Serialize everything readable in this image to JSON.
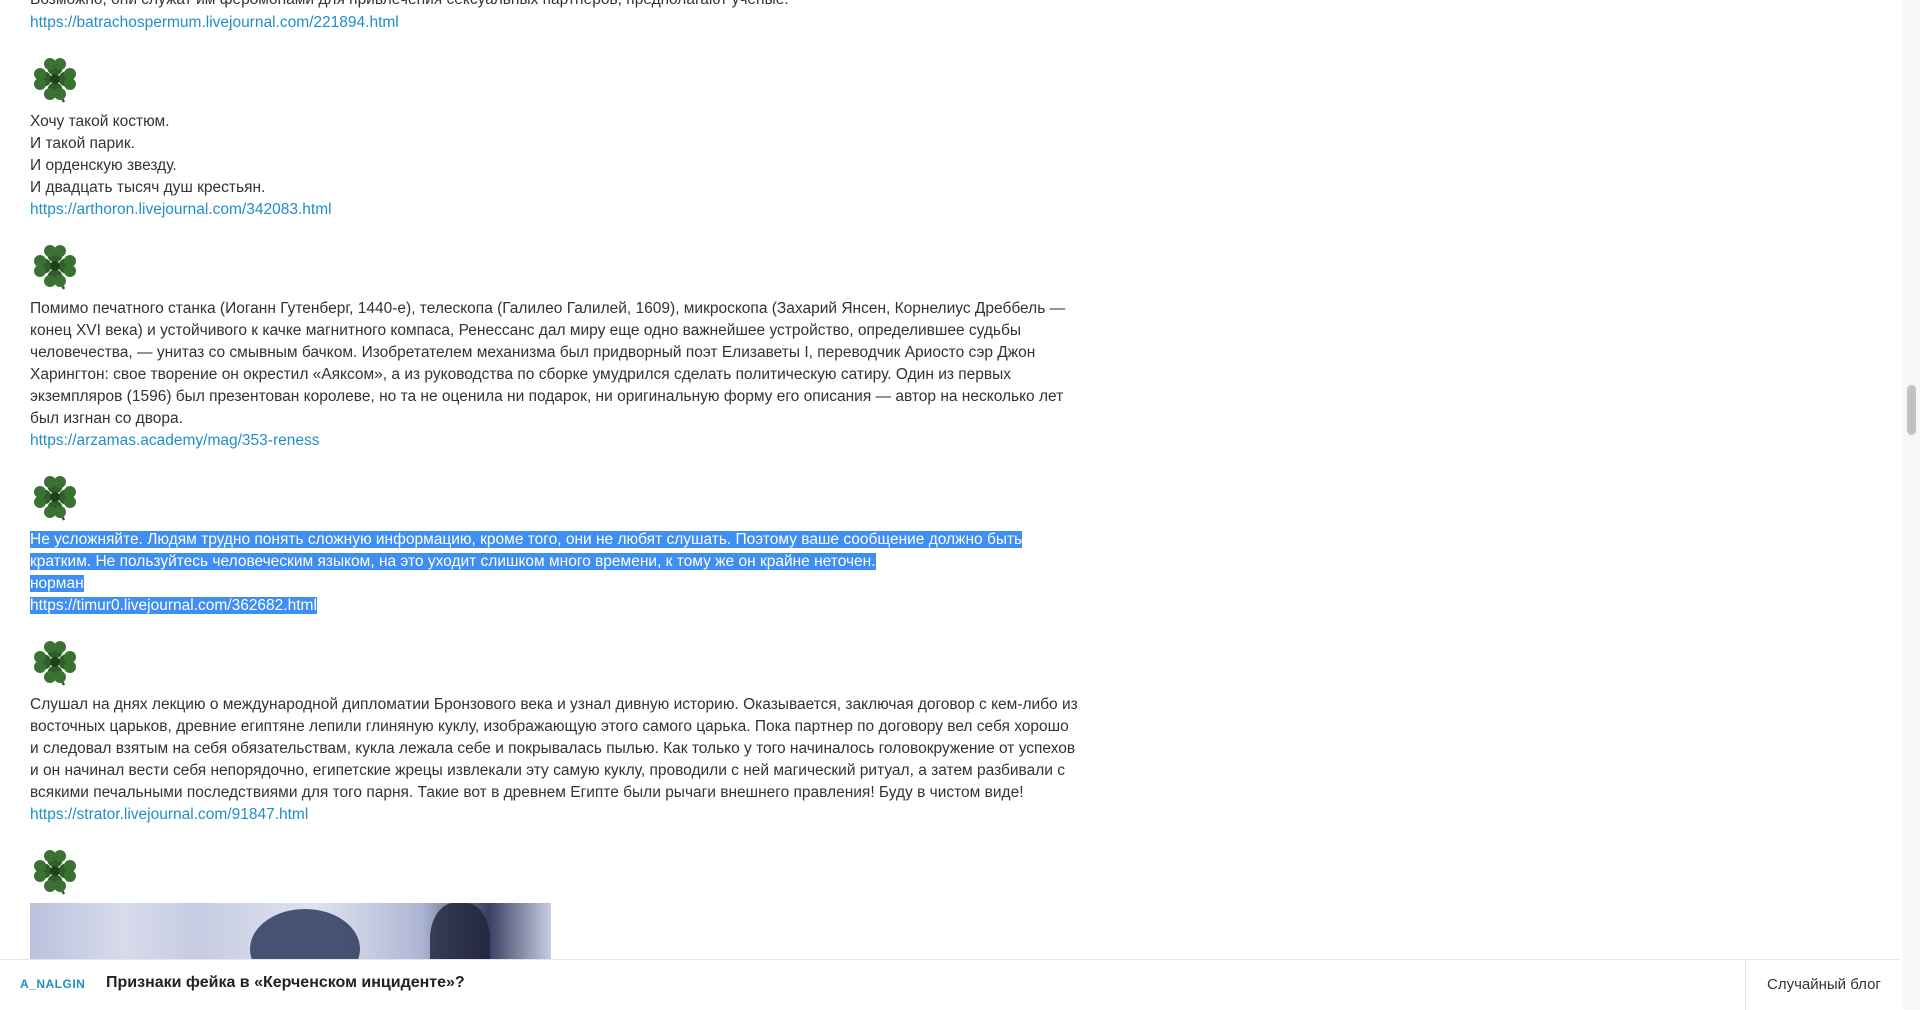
{
  "posts": {
    "p1": {
      "text": [
        "Возможно, они служат им феромонами для привлечения сексуальных партнеров, предполагают ученые."
      ],
      "link": "https://batrachospermum.livejournal.com/221894.html"
    },
    "p2": {
      "text": [
        "Хочу такой костюм.",
        "И такой парик.",
        "И орденскую звезду.",
        "И двадцать тысяч душ крестьян."
      ],
      "link": "https://arthoron.livejournal.com/342083.html"
    },
    "p3": {
      "text": [
        "Помимо печатного станка (Иоганн Гутенберг, 1440-е), телескопа (Галилео Галилей, 1609), микроскопа (Захарий Янсен, Корнелиус Дреббель —",
        "конец XVI века) и устойчивого к качке магнитного компаса, Ренессанс дал миру еще одно важнейшее устройство, определившее судьбы",
        "человечества, — унитаз со смывным бачком. Изобретателем механизма был придворный поэт Елизаветы I, переводчик Ариосто сэр Джон",
        "Харингтон: свое творение он окрестил «Аяксом», а из руководства по сборке умудрился сделать политическую сатиру. Один из первых",
        "экземпляров (1596) был презентован королеве, но та не оценила ни подарок, ни оригинальную форму его описания — автор на несколько лет",
        "был изгнан со двора."
      ],
      "link": "https://arzamas.academy/mag/353-reness"
    },
    "p4": {
      "text": [
        "Не усложняйте. Людям трудно понять сложную информацию, кроме того, они не любят слушать. Поэтому ваше сообщение должно быть",
        "кратким. Не пользуйтесь человеческим языком, на это уходит слишком много времени, к тому же он крайне неточен.",
        "норман"
      ],
      "link": "https://timur0.livejournal.com/362682.html"
    },
    "p5": {
      "text": [
        "Слушал на днях лекцию о международной дипломатии Бронзового века и узнал дивную историю. Оказывается, заключая договор с кем-либо из",
        "восточных царьков, древние египтяне лепили глиняную куклу, изображающую этого самого царька. Пока партнер по договору вел себя хорошо",
        "и следовал взятым на себя обязательствам, кукла лежала себе и покрывалась пылью. Как только у того начиналось головокружение от успехов",
        "и он начинал вести себя непорядочно, египетские жрецы извлекали эту самую куклу, проводили с ней магический ритуал, а затем разбивали с",
        "всякими печальными последствиями для того парня. Такие вот в древнем Египте были рычаги внешнего правления! Буду в чистом виде!"
      ],
      "link": "https://strator.livejournal.com/91847.html"
    }
  },
  "footer": {
    "author": "A_NALGIN",
    "title": "Признаки фейка в «Керченском инциденте»?",
    "random_blog": "Случайный блог"
  },
  "colors": {
    "link": "#1f8fc7",
    "selection": "#3f8ef2",
    "text": "#333333"
  },
  "icons": {
    "post_separator": "clover-icon"
  }
}
